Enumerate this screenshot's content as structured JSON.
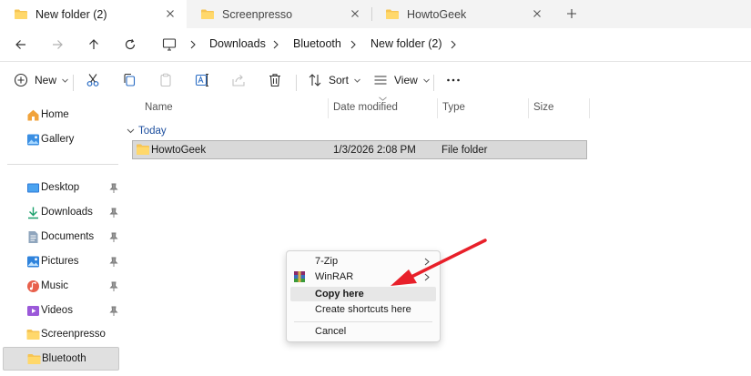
{
  "tabs": [
    {
      "label": "New folder (2)",
      "active": true
    },
    {
      "label": "Screenpresso",
      "active": false
    },
    {
      "label": "HowtoGeek",
      "active": false
    }
  ],
  "breadcrumb": [
    "Downloads",
    "Bluetooth",
    "New folder (2)"
  ],
  "toolbar": {
    "new_label": "New",
    "sort_label": "Sort",
    "view_label": "View"
  },
  "sidebar": {
    "quick": [
      {
        "label": "Home",
        "icon": "home-icon"
      },
      {
        "label": "Gallery",
        "icon": "gallery-icon"
      }
    ],
    "pinned": [
      {
        "label": "Desktop",
        "icon": "desktop-icon"
      },
      {
        "label": "Downloads",
        "icon": "download-icon"
      },
      {
        "label": "Documents",
        "icon": "documents-icon"
      },
      {
        "label": "Pictures",
        "icon": "pictures-icon"
      },
      {
        "label": "Music",
        "icon": "music-icon"
      },
      {
        "label": "Videos",
        "icon": "videos-icon"
      }
    ],
    "folders": [
      {
        "label": "Screenpresso",
        "icon": "folder-icon"
      },
      {
        "label": "Bluetooth",
        "icon": "folder-icon",
        "selected": true
      }
    ]
  },
  "columns": [
    "Name",
    "Date modified",
    "Type",
    "Size"
  ],
  "group": {
    "label": "Today"
  },
  "files": [
    {
      "name": "HowtoGeek",
      "date": "1/3/2026 2:08 PM",
      "type": "File folder",
      "size": ""
    }
  ],
  "context_menu": {
    "items": [
      {
        "label": "7-Zip",
        "submenu": true
      },
      {
        "label": "WinRAR",
        "submenu": true,
        "icon": "winrar-icon"
      },
      {
        "label": "Copy here",
        "bold": true,
        "highlighted": true
      },
      {
        "label": "Create shortcuts here"
      },
      {
        "label": "Cancel"
      }
    ]
  },
  "colors": {
    "accent_arrow": "#e8202a",
    "folder": "#f6c453",
    "selection": "#d9d9d9",
    "group_text": "#1c4e9e"
  }
}
